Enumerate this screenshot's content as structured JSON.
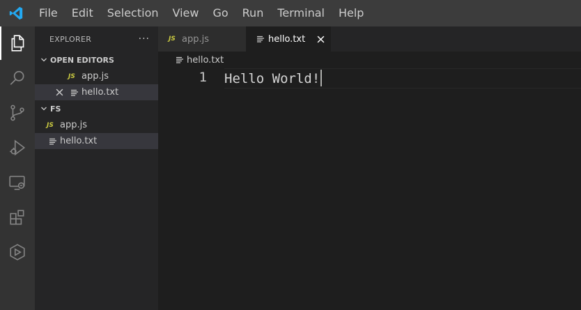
{
  "menu": [
    "File",
    "Edit",
    "Selection",
    "View",
    "Go",
    "Run",
    "Terminal",
    "Help"
  ],
  "activity": [
    "explorer-icon",
    "search-icon",
    "source-control-icon",
    "run-debug-icon",
    "remote-explorer-icon",
    "extensions-icon",
    "live-share-icon"
  ],
  "sidebar": {
    "title": "EXPLORER",
    "more": "···",
    "open_editors": {
      "title": "OPEN EDITORS",
      "items": [
        {
          "badge": "JS",
          "label": "app.js"
        },
        {
          "label": "hello.txt"
        }
      ]
    },
    "folder": {
      "title": "FS",
      "items": [
        {
          "badge": "JS",
          "label": "app.js"
        },
        {
          "label": "hello.txt"
        }
      ]
    }
  },
  "tabs": [
    {
      "badge": "JS",
      "label": "app.js"
    },
    {
      "label": "hello.txt"
    }
  ],
  "breadcrumb": "hello.txt",
  "editor": {
    "line_number": "1",
    "line_text": "Hello World!"
  },
  "colors": {
    "accent": "#007acc",
    "js_badge": "#cbcb41",
    "titlebar": "#3c3c3c"
  }
}
